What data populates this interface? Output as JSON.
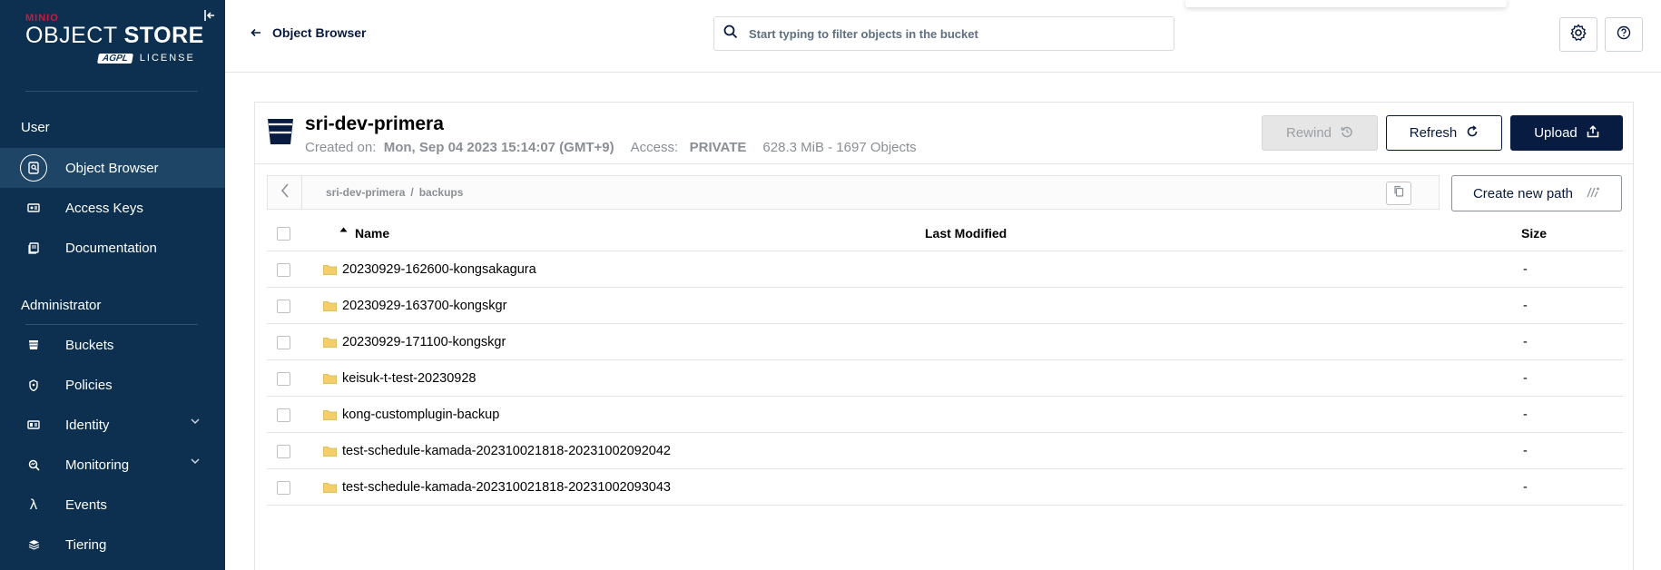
{
  "logo": {
    "brand": "MINIO",
    "product_light": "OBJECT",
    "product_bold": "STORE",
    "license_badge": "AGPL",
    "license": "LICENSE"
  },
  "sidebar": {
    "sections": [
      {
        "title": "User",
        "items": [
          {
            "label": "Object Browser",
            "icon": "object-browser-icon",
            "active": true
          },
          {
            "label": "Access Keys",
            "icon": "access-keys-icon"
          },
          {
            "label": "Documentation",
            "icon": "documentation-icon"
          }
        ]
      },
      {
        "title": "Administrator",
        "items": [
          {
            "label": "Buckets",
            "icon": "bucket-icon"
          },
          {
            "label": "Policies",
            "icon": "policy-icon"
          },
          {
            "label": "Identity",
            "icon": "identity-icon",
            "expandable": true
          },
          {
            "label": "Monitoring",
            "icon": "monitoring-icon",
            "expandable": true
          },
          {
            "label": "Events",
            "icon": "lambda-icon"
          },
          {
            "label": "Tiering",
            "icon": "tiering-icon"
          }
        ]
      }
    ]
  },
  "header": {
    "back_label": "Object Browser",
    "search_placeholder": "Start typing to filter objects in the bucket"
  },
  "bucket": {
    "name": "sri-dev-primera",
    "created_label": "Created on:",
    "created_value": "Mon, Sep 04 2023 15:14:07 (GMT+9)",
    "access_label": "Access:",
    "access_value": "PRIVATE",
    "usage": "628.3 MiB - 1697 Objects",
    "rewind_label": "Rewind",
    "refresh_label": "Refresh",
    "upload_label": "Upload"
  },
  "breadcrumb": {
    "bucket": "sri-dev-primera",
    "separator": "/",
    "folder": "backups"
  },
  "create_path_label": "Create new path",
  "table": {
    "columns": {
      "name": "Name",
      "modified": "Last Modified",
      "size": "Size"
    },
    "rows": [
      {
        "name": "20230929-162600-kongsakagura",
        "modified": "",
        "size": "-"
      },
      {
        "name": "20230929-163700-kongskgr",
        "modified": "",
        "size": "-"
      },
      {
        "name": "20230929-171100-kongskgr",
        "modified": "",
        "size": "-"
      },
      {
        "name": "keisuk-t-test-20230928",
        "modified": "",
        "size": "-"
      },
      {
        "name": "kong-customplugin-backup",
        "modified": "",
        "size": "-"
      },
      {
        "name": "test-schedule-kamada-202310021818-20231002092042",
        "modified": "",
        "size": "-"
      },
      {
        "name": "test-schedule-kamada-202310021818-20231002093043",
        "modified": "",
        "size": "-"
      }
    ]
  },
  "colors": {
    "sidebar_bg": "#0d3050",
    "sidebar_active": "#1f4566",
    "primary": "#081c42",
    "folder": "#f2cf6b"
  }
}
